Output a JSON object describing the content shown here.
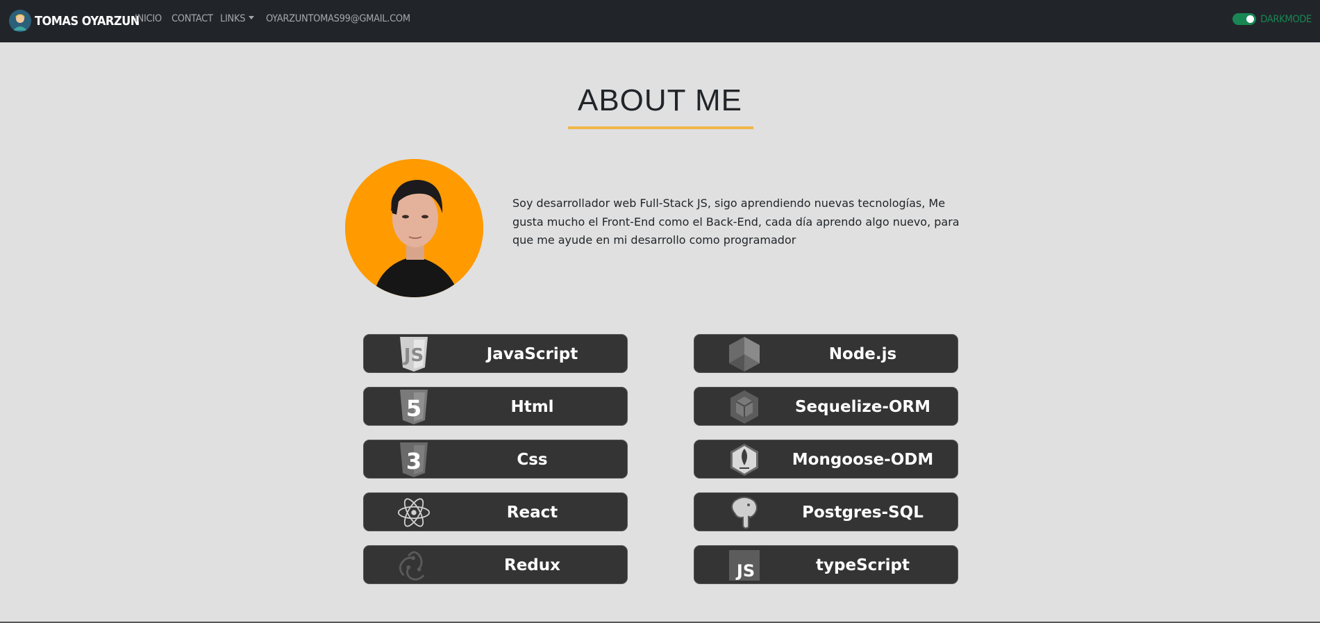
{
  "navbar": {
    "brand": "TOMAS OYARZUN",
    "links": [
      "INICIO",
      "CONTACT",
      "LINKS",
      "OYARZUNTOMAS99@GMAIL.COM"
    ],
    "darkmode_label": "DARKMODE",
    "darkmode_on": true,
    "colors": {
      "background": "#212529",
      "link": "#a5a7aa",
      "toggle": "#198754"
    }
  },
  "about": {
    "title": "ABOUT ME",
    "text": "Soy desarrollador web Full-Stack JS, sigo aprendiendo nuevas tecnologías, Me gusta mucho el Front-End como el Back-End, cada día aprendo algo nuevo, para que me ayude en mi desarrollo como programador",
    "colors": {
      "underline": "#f0b64a",
      "avatar_bg": "#ff9a00"
    }
  },
  "skills": {
    "left": [
      {
        "label": "JavaScript",
        "icon": "javascript-icon"
      },
      {
        "label": "Html",
        "icon": "html5-icon"
      },
      {
        "label": "Css",
        "icon": "css3-icon"
      },
      {
        "label": "React",
        "icon": "react-icon"
      },
      {
        "label": "Redux",
        "icon": "redux-icon"
      }
    ],
    "right": [
      {
        "label": "Node.js",
        "icon": "nodejs-icon"
      },
      {
        "label": "Sequelize-ORM",
        "icon": "sequelize-icon"
      },
      {
        "label": "Mongoose-ODM",
        "icon": "mongoose-icon"
      },
      {
        "label": "Postgres-SQL",
        "icon": "postgresql-icon"
      },
      {
        "label": "typeScript",
        "icon": "typescript-icon",
        "icon_text": "JS"
      }
    ],
    "colors": {
      "card_bg": "#343434"
    }
  }
}
